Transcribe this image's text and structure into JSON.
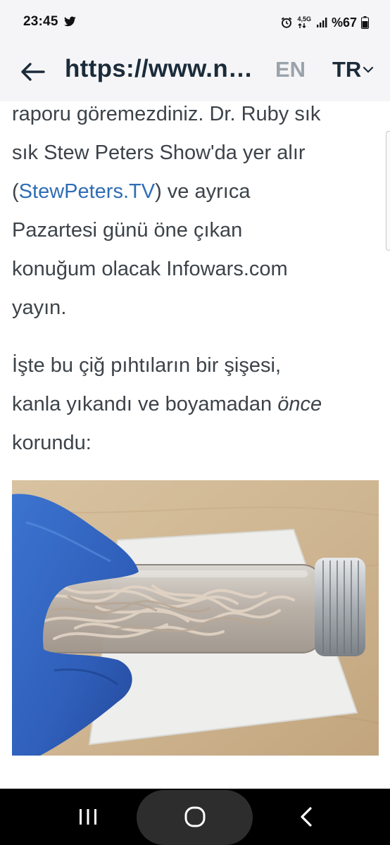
{
  "status_bar": {
    "time": "23:45",
    "network_label": "4,5G",
    "battery": "%67",
    "icons": [
      "twitter-icon",
      "alarm-icon",
      "network-arrows-icon",
      "signal-icon",
      "battery-icon"
    ]
  },
  "toolbar": {
    "url": "https://www.newswars.com",
    "lang_en": "EN",
    "lang_tr": "TR",
    "icons": [
      "back-arrow-icon",
      "chevron-down-icon"
    ]
  },
  "article": {
    "p1": {
      "line1": "raporu göremezdiniz. Dr. Ruby sık",
      "line2": "sık Stew Peters Show'da yer alır",
      "line3_open": "(",
      "line3_link": "StewPeters.TV",
      "line3_rest": ") ve ayrıca",
      "line4": "Pazartesi günü öne çıkan",
      "line5": "konuğum olacak Infowars.com",
      "line6": "yayın."
    },
    "p2": {
      "line1": "İşte bu çiğ pıhtıların bir şişesi,",
      "line2_a": "kanla yıkandı ve boyamadan ",
      "line2_em": "önce",
      "line3": "korundu:"
    }
  },
  "colors": {
    "text": "#3c4349",
    "link": "#2f6db5",
    "bar_bg": "#f5f5f7",
    "nav_bg": "#000000"
  },
  "nav_bar": {
    "icons": [
      "recent-apps-icon",
      "home-icon",
      "back-icon"
    ]
  }
}
